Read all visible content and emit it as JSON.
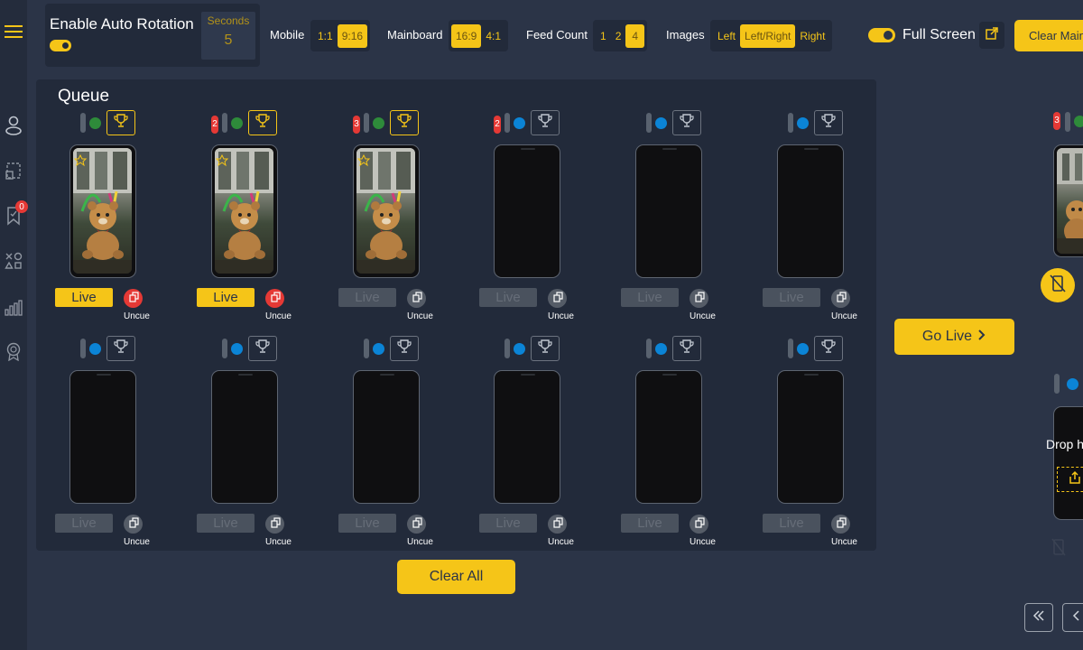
{
  "top_bar": {
    "rotation_label": "Enable Auto Rotation",
    "rotation_enabled": true,
    "seconds_label": "Seconds",
    "seconds_value": "5",
    "mobile": {
      "label": "Mobile",
      "options": [
        "1:1",
        "9:16"
      ],
      "selected": "9:16"
    },
    "mainboard": {
      "label": "Mainboard",
      "options": [
        "16:9",
        "4:1"
      ],
      "selected": "16:9"
    },
    "feed_count": {
      "label": "Feed Count",
      "options": [
        "1",
        "2",
        "4"
      ],
      "selected": "4"
    },
    "images": {
      "label": "Images",
      "options": [
        "Left",
        "Left/Right",
        "Right"
      ],
      "selected": "Left/Right"
    },
    "full_screen_label": "Full Screen",
    "full_screen_enabled": true,
    "clear_main_label": "Clear Mainboard"
  },
  "sidebar": {
    "items": [
      "menu-icon",
      "user-icon",
      "select-icon",
      "bookmark-icon",
      "shapes-icon",
      "chart-icon",
      "badge-icon"
    ],
    "bookmark_badge": "0"
  },
  "queue": {
    "title": "Queue",
    "slots": [
      {
        "badge": "",
        "dot": "green",
        "trophy_active": true,
        "has_image": true,
        "live_active": true,
        "uncue_active": true
      },
      {
        "badge": "2",
        "dot": "green",
        "trophy_active": true,
        "has_image": true,
        "live_active": true,
        "uncue_active": true
      },
      {
        "badge": "3",
        "dot": "green",
        "trophy_active": true,
        "has_image": true,
        "live_active": false,
        "uncue_active": false
      },
      {
        "badge": "2",
        "dot": "blue",
        "trophy_active": false,
        "has_image": false,
        "live_active": false,
        "uncue_active": false
      },
      {
        "badge": "",
        "dot": "blue",
        "trophy_active": false,
        "has_image": false,
        "live_active": false,
        "uncue_active": false
      },
      {
        "badge": "",
        "dot": "blue",
        "trophy_active": false,
        "has_image": false,
        "live_active": false,
        "uncue_active": false
      },
      {
        "badge": "",
        "dot": "blue",
        "trophy_active": false,
        "has_image": false,
        "live_active": false,
        "uncue_active": false
      },
      {
        "badge": "",
        "dot": "blue",
        "trophy_active": false,
        "has_image": false,
        "live_active": false,
        "uncue_active": false
      },
      {
        "badge": "",
        "dot": "blue",
        "trophy_active": false,
        "has_image": false,
        "live_active": false,
        "uncue_active": false
      },
      {
        "badge": "",
        "dot": "blue",
        "trophy_active": false,
        "has_image": false,
        "live_active": false,
        "uncue_active": false
      },
      {
        "badge": "",
        "dot": "blue",
        "trophy_active": false,
        "has_image": false,
        "live_active": false,
        "uncue_active": false
      },
      {
        "badge": "",
        "dot": "blue",
        "trophy_active": false,
        "has_image": false,
        "live_active": false,
        "uncue_active": false
      }
    ],
    "live_label": "Live",
    "uncue_label": "Uncue",
    "clear_all_label": "Clear All"
  },
  "go_live_label": "Go Live",
  "right_panel": {
    "badge": "3",
    "drop_text": "Drop here"
  },
  "colors": {
    "accent": "#f5c518",
    "background": "#2b3447",
    "panel": "#222a3a",
    "red": "#e53935",
    "green": "#2e8b3a",
    "blue": "#0b84d6"
  }
}
